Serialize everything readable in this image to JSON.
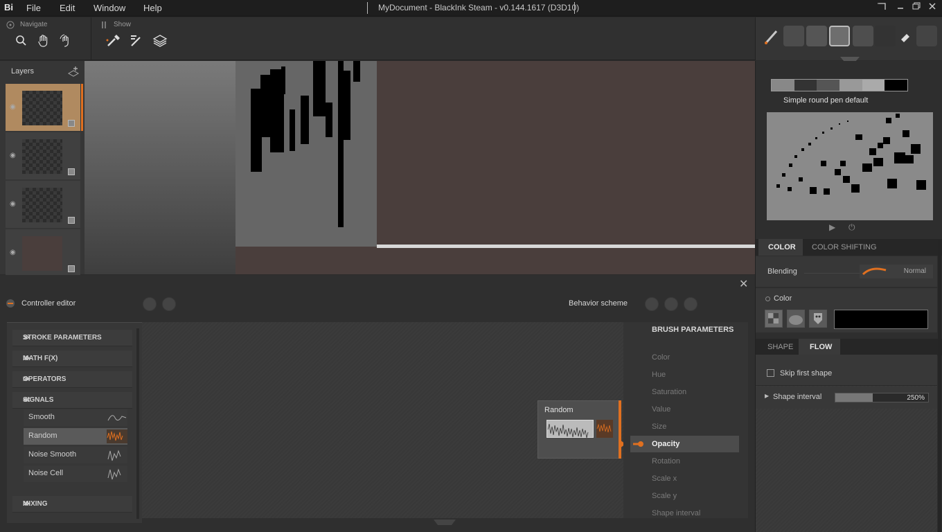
{
  "app": {
    "logo": "Bi",
    "title": "MyDocument - BlackInk Steam - v0.144.1617 (D3D10)"
  },
  "menu": [
    "File",
    "Edit",
    "Window",
    "Help"
  ],
  "toolbar": {
    "navigate_label": "Navigate",
    "show_label": "Show"
  },
  "layers": {
    "title": "Layers"
  },
  "brush": {
    "name": "Simple round pen default"
  },
  "color_tabs": [
    "COLOR",
    "COLOR SHIFTING"
  ],
  "blending": {
    "label": "Blending",
    "value": "Normal"
  },
  "color": {
    "label": "Color",
    "swatch": "#000000"
  },
  "flow_tabs": [
    "SHAPE",
    "FLOW"
  ],
  "flow": {
    "skip_first_shape": "Skip first shape",
    "shape_interval_label": "Shape interval",
    "shape_interval_value": "250%",
    "shape_interval_fill": 0.4
  },
  "controller": {
    "title": "Controller editor",
    "behavior": "Behavior scheme",
    "sections": [
      "STROKE PARAMETERS",
      "MATH F(X)",
      "OPERATORS",
      "SIGNALS",
      "MIXING"
    ],
    "signals": [
      "Smooth",
      "Random",
      "Noise Smooth",
      "Noise Cell"
    ],
    "node_title": "Random",
    "brush_params_title": "BRUSH PARAMETERS",
    "brush_params": [
      "Color",
      "Hue",
      "Saturation",
      "Value",
      "Size",
      "Opacity",
      "Rotation",
      "Scale x",
      "Scale y",
      "Shape interval"
    ]
  },
  "colors": {
    "accent": "#e07020",
    "layer_selected": "#b08a60"
  }
}
